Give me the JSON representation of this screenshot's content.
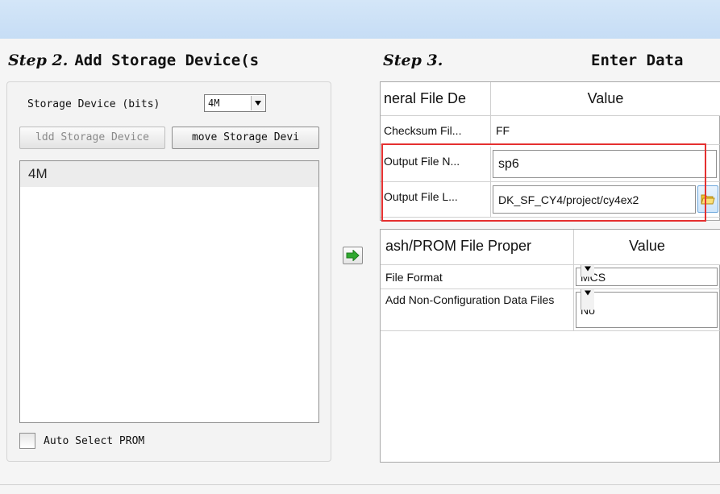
{
  "header": {
    "bar": ""
  },
  "step2": {
    "prefix": "Step 2.",
    "title": "Add Storage Device(s",
    "device_label": "Storage Device (bits)",
    "device_value": "4M",
    "add_button": "ldd Storage Device",
    "remove_button": "move Storage Devi",
    "devices": [
      "4M"
    ],
    "auto_select_label": "Auto Select PROM"
  },
  "step3": {
    "prefix": "Step 3.",
    "title": "Enter Data",
    "general_grid": {
      "header_property": "neral File De",
      "header_value": "Value",
      "rows": [
        {
          "label": "Checksum Fil...",
          "value": "FF"
        },
        {
          "label": "Output File N...",
          "value": "sp6"
        },
        {
          "label": "Output File L...",
          "value": "DK_SF_CY4/project/cy4ex2"
        }
      ]
    },
    "prom_grid": {
      "header_property": "ash/PROM File Proper",
      "header_value": "Value",
      "rows": [
        {
          "label": "File Format",
          "value": "MCS"
        },
        {
          "label": "Add Non-Configuration Data Files",
          "value": "No"
        }
      ]
    }
  },
  "icons": {
    "transfer": "green-right-arrow-icon",
    "browse": "folder-icon",
    "dropdown": "chevron-down-icon"
  },
  "colors": {
    "title_bar": "#c6ddf5",
    "highlight_border": "#e53030",
    "arrow_green": "#2fa82f",
    "folder_yellow": "#f3c431"
  }
}
